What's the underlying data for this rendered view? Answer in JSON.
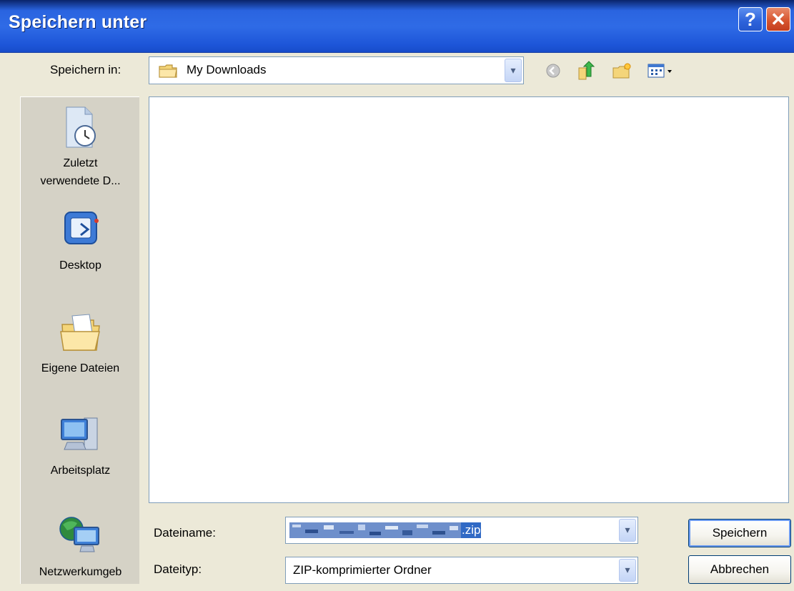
{
  "window": {
    "title": "Speichern unter",
    "help_icon": "help-icon",
    "close_icon": "close-icon"
  },
  "look_in": {
    "label": "Speichern in:",
    "value": "My Downloads",
    "folder_icon": "folder-icon"
  },
  "toolbar": {
    "icons": [
      "back-icon",
      "up-folder-icon",
      "new-folder-icon",
      "views-menu-icon"
    ]
  },
  "places": [
    {
      "label_line1": "Zuletzt",
      "label_line2": "verwendete D...",
      "icon": "recent-documents-icon"
    },
    {
      "label_line1": "Desktop",
      "label_line2": "",
      "icon": "desktop-icon"
    },
    {
      "label_line1": "Eigene Dateien",
      "label_line2": "",
      "icon": "my-documents-icon"
    },
    {
      "label_line1": "Arbeitsplatz",
      "label_line2": "",
      "icon": "my-computer-icon"
    },
    {
      "label_line1": "Netzwerkumgeb",
      "label_line2": "",
      "icon": "network-icon"
    }
  ],
  "filename": {
    "label": "Dateiname:",
    "value_suffix": ".zip"
  },
  "filetype": {
    "label": "Dateityp:",
    "value": "ZIP-komprimierter Ordner"
  },
  "buttons": {
    "save": "Speichern",
    "cancel": "Abbrechen"
  },
  "colors": {
    "titlebar": "#2F6BE6",
    "dialog_bg": "#ECE9D8",
    "selection": "#316AC5"
  }
}
